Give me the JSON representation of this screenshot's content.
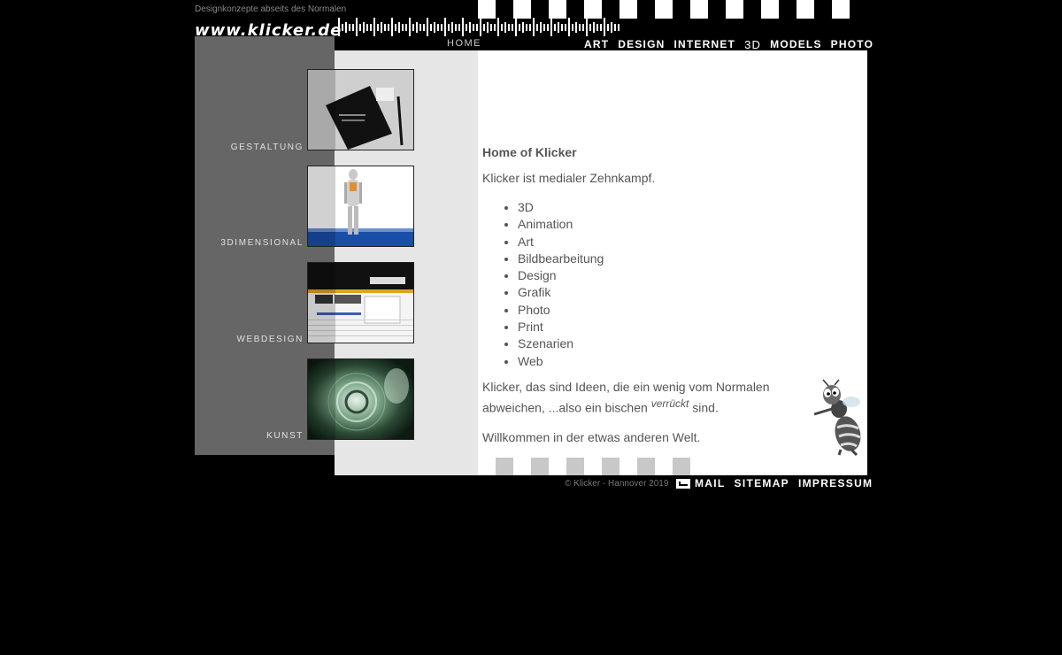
{
  "header": {
    "tagline": "Designkonzepte abseits des Normalen",
    "logo": "www.klicker.de"
  },
  "nav_top": {
    "home": "HOME",
    "items": [
      "ART",
      "DESIGN",
      "INTERNET",
      "3D",
      "MODELS",
      "PHOTO"
    ]
  },
  "sidebar": {
    "items": [
      {
        "label": "GESTALTUNG"
      },
      {
        "label": "3DIMENSIONAL"
      },
      {
        "label": "WEBDESIGN"
      },
      {
        "label": "KUNST"
      }
    ]
  },
  "content": {
    "heading": "Home of Klicker",
    "intro": "Klicker ist medialer Zehnkampf.",
    "list": [
      "3D",
      "Animation",
      "Art",
      "Bildbearbeitung",
      "Design",
      "Grafik",
      "Photo",
      "Print",
      "Szenarien",
      "Web"
    ],
    "para2_a": "Klicker, das sind Ideen, die ein wenig vom Normalen abweichen, ...also ein bischen",
    "para2_em": "verrückt",
    "para2_b": "sind.",
    "para3": "Willkommen in der etwas anderen Welt."
  },
  "footer": {
    "copyright": "© Klicker - Hannover 2019",
    "links": [
      "MAIL",
      "SITEMAP",
      "IMPRESSUM"
    ]
  },
  "colors": {
    "background": "#000000",
    "sidebar_dark": "#666666",
    "sidebar_light": "#e6e6e6",
    "text": "#555555"
  },
  "icons": [
    "mail-icon",
    "bee-mascot"
  ]
}
